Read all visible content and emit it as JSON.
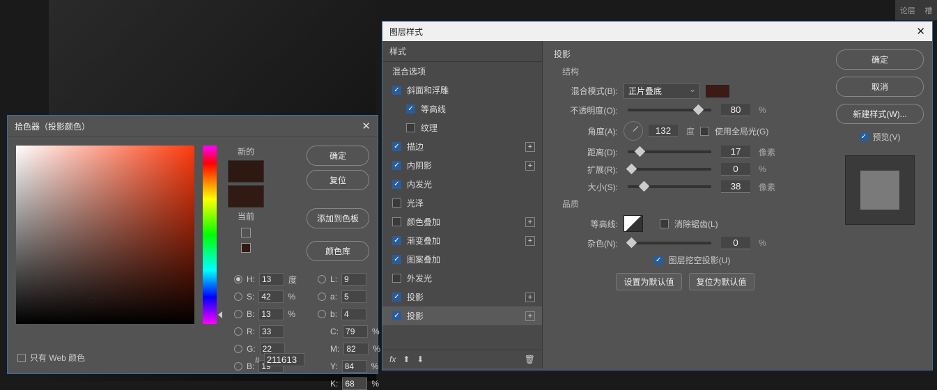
{
  "side_tabs": {
    "t1": "论层",
    "t2": "槽"
  },
  "picker": {
    "title": "拾色器（投影颜色）",
    "ok": "确定",
    "reset": "复位",
    "add_swatch": "添加到色板",
    "color_lib": "颜色库",
    "new_label": "新的",
    "current_label": "当前",
    "web_only": "只有 Web 颜色",
    "H": {
      "label": "H:",
      "val": "13",
      "unit": "度"
    },
    "S": {
      "label": "S:",
      "val": "42",
      "unit": "%"
    },
    "Bv": {
      "label": "B:",
      "val": "13",
      "unit": "%"
    },
    "R": {
      "label": "R:",
      "val": "33"
    },
    "G": {
      "label": "G:",
      "val": "22"
    },
    "Bb": {
      "label": "B:",
      "val": "19"
    },
    "L": {
      "label": "L:",
      "val": "9"
    },
    "a": {
      "label": "a:",
      "val": "5"
    },
    "b": {
      "label": "b:",
      "val": "4"
    },
    "C": {
      "label": "C:",
      "val": "79",
      "unit": "%"
    },
    "M": {
      "label": "M:",
      "val": "82",
      "unit": "%"
    },
    "Y": {
      "label": "Y:",
      "val": "84",
      "unit": "%"
    },
    "K": {
      "label": "K:",
      "val": "68",
      "unit": "%"
    },
    "hex_prefix": "#",
    "hex": "211613",
    "new_color": "#2e1812",
    "cur_color": "#321a14"
  },
  "ls": {
    "title": "图层样式",
    "left_head": "样式",
    "blend_opts": "混合选项",
    "items": {
      "bevel": "斜面和浮雕",
      "contour_i": "等高线",
      "texture": "纹理",
      "stroke": "描边",
      "inner_shadow": "内阴影",
      "inner_glow": "内发光",
      "satin": "光泽",
      "color_ov": "颜色叠加",
      "grad_ov": "渐变叠加",
      "pat_ov": "图案叠加",
      "outer_glow": "外发光",
      "drop1": "投影",
      "drop2": "投影"
    },
    "section": "投影",
    "structure": "结构",
    "quality": "品质",
    "blend_mode_l": "混合模式(B):",
    "blend_mode_v": "正片叠底",
    "opacity_l": "不透明度(O):",
    "opacity_v": "80",
    "pct": "%",
    "angle_l": "角度(A):",
    "angle_v": "132",
    "deg": "度",
    "global_l": "使用全局光(G)",
    "distance_l": "距离(D):",
    "distance_v": "17",
    "px": "像素",
    "spread_l": "扩展(R):",
    "spread_v": "0",
    "size_l": "大小(S):",
    "size_v": "38",
    "contour_l": "等高线:",
    "aa_l": "消除锯齿(L)",
    "noise_l": "杂色(N):",
    "noise_v": "0",
    "knockout": "图层挖空投影(U)",
    "defaults": "设置为默认值",
    "reset_def": "复位为默认值",
    "ok": "确定",
    "cancel": "取消",
    "new_style": "新建样式(W)...",
    "preview": "预览(V)",
    "fx": "fx"
  }
}
